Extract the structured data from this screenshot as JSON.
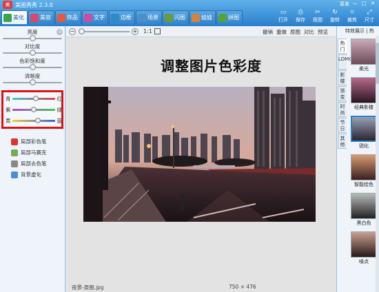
{
  "app": {
    "title": "美图秀秀 2.3.0",
    "window_controls": [
      "菜单",
      "—",
      "□",
      "✕"
    ]
  },
  "tabs": [
    {
      "label": "美化",
      "icon": "palette-icon",
      "color": "#3fa14a",
      "active": true
    },
    {
      "label": "美容",
      "icon": "face-icon",
      "color": "#d64a6b"
    },
    {
      "label": "饰品",
      "icon": "heart-icon",
      "color": "#e35a3d"
    },
    {
      "label": "文字",
      "icon": "text-icon",
      "color": "#c94fa3"
    },
    {
      "label": "边框",
      "icon": "frame-icon",
      "color": "#2e8ac5"
    },
    {
      "label": "场景",
      "icon": "scene-icon",
      "color": "#4a8fc9"
    },
    {
      "label": "闪图",
      "icon": "flash-icon",
      "color": "#6b9a3a"
    },
    {
      "label": "娃娃",
      "icon": "doll-icon",
      "color": "#d7813c"
    },
    {
      "label": "拼图",
      "icon": "puzzle-icon",
      "color": "#56a337"
    }
  ],
  "top_tools": [
    {
      "label": "打开",
      "glyph": "▭"
    },
    {
      "label": "保存",
      "glyph": "⎙"
    },
    {
      "label": "抠图",
      "glyph": "✂"
    },
    {
      "label": "旋转",
      "glyph": "↻"
    },
    {
      "label": "裁剪",
      "glyph": "⌗"
    },
    {
      "label": "尺寸",
      "glyph": "⤢"
    }
  ],
  "basic_adjust": [
    {
      "label": "亮度",
      "level": 0.5
    },
    {
      "label": "对比度",
      "level": 0.5
    },
    {
      "label": "色彩饱和度",
      "level": 0.5
    },
    {
      "label": "清晰度",
      "level": 0.5
    }
  ],
  "color_balance": [
    {
      "left": "青",
      "right": "红",
      "level": 0.55,
      "gradient": [
        "#3fc6d6",
        "#e04040"
      ]
    },
    {
      "left": "紫",
      "right": "绿",
      "level": 0.5,
      "gradient": [
        "#b04bd0",
        "#4fc04f"
      ]
    },
    {
      "left": "黄",
      "right": "蓝",
      "level": 0.6,
      "gradient": [
        "#e8d23a",
        "#3a64d8"
      ]
    }
  ],
  "brushes": [
    {
      "label": "局部彩色笔",
      "color": "#d33"
    },
    {
      "label": "局部马赛克",
      "color": "#7a5"
    },
    {
      "label": "局部去色笔",
      "color": "#888"
    },
    {
      "label": "背景虚化",
      "color": "#4a8fd6"
    }
  ],
  "canvas_toolbar": {
    "zoom_ratio": "1:1",
    "actions": [
      "撤销",
      "重做",
      "原图",
      "对比",
      "预览"
    ]
  },
  "headline": "调整图片色彩度",
  "status": {
    "file": "夜景-原图.jpg",
    "size": "750 × 476"
  },
  "right_panel": {
    "header": "特效展示 | 热",
    "vtabs": [
      "热门",
      "LOMO",
      "影楼",
      "渐变",
      "时尚",
      "节日",
      "其他"
    ],
    "thumbs": [
      {
        "label": "柔光",
        "colors": [
          "#c9aab5",
          "#6e4a5a"
        ]
      },
      {
        "label": "经典影楼",
        "colors": [
          "#b56a8a",
          "#2a1522"
        ]
      },
      {
        "label": "锐化",
        "colors": [
          "#9aa0b8",
          "#2a2530"
        ],
        "selected": true
      },
      {
        "label": "智能绘色",
        "colors": [
          "#d89a70",
          "#3a2020"
        ]
      },
      {
        "label": "黑白色",
        "colors": [
          "#bbbbbb",
          "#222222"
        ]
      },
      {
        "label": "噪点",
        "colors": [
          "#c8a090",
          "#2a1818"
        ]
      }
    ]
  }
}
